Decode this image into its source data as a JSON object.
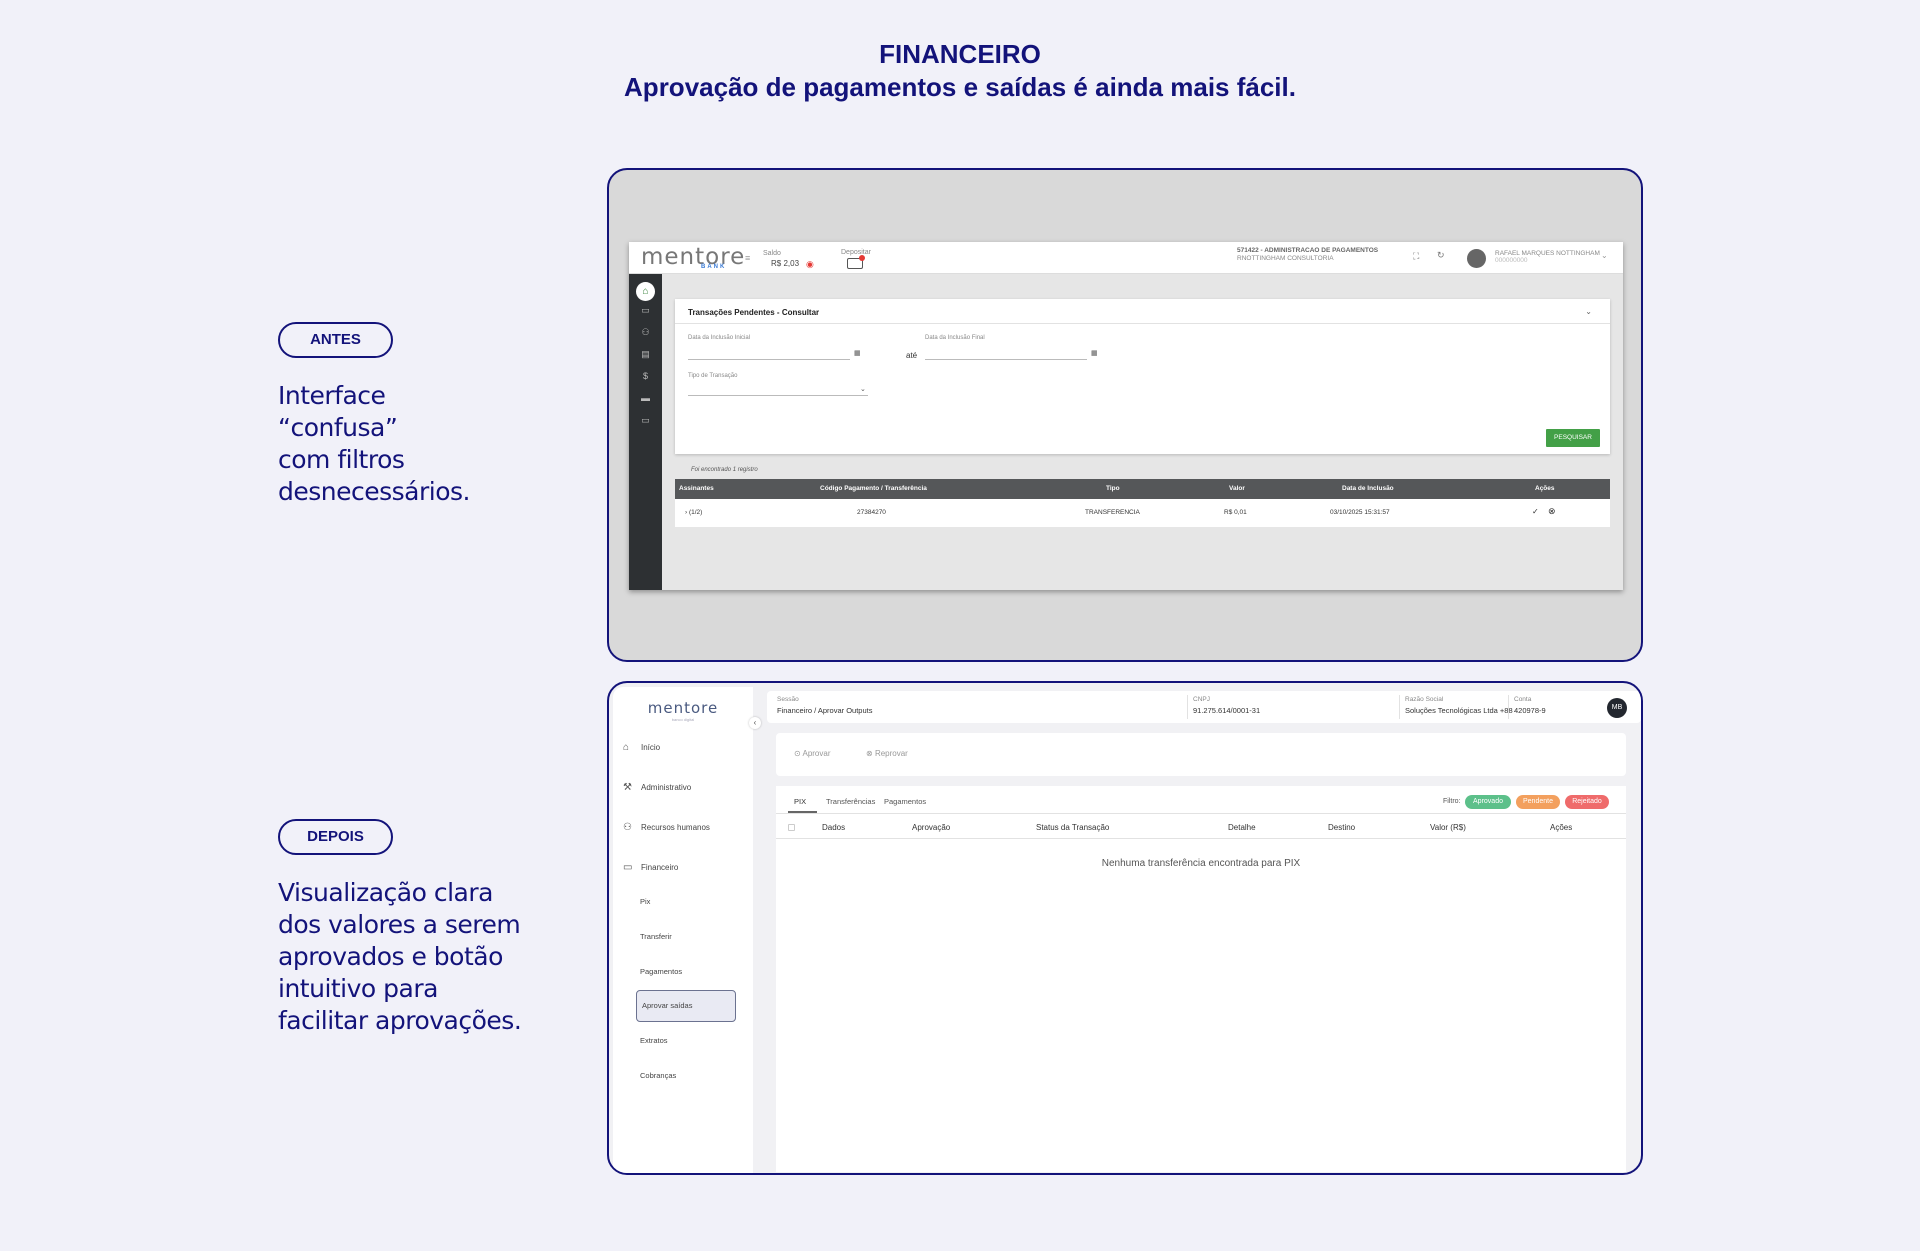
{
  "header": {
    "title": "FINANCEIRO",
    "subtitle": "Aprovação de pagamentos e saídas é ainda mais fácil."
  },
  "before": {
    "tag": "ANTES",
    "description": "Interface\n“confusa”\ncom filtros\ndesnecessários.",
    "app": {
      "logo": "mentore",
      "logo_sub": "BANK",
      "saldo_label": "Saldo",
      "saldo_value": "R$ 2,03",
      "depositar_label": "Depositar",
      "account_line1": "571422 - ADMINISTRACAO DE PAGAMENTOS",
      "account_line2": "RNOTTINGHAM CONSULTORIA",
      "user_name": "RAFAEL MARQUES NOTTINGHAM",
      "user_sub": "000000000",
      "card_title": "Transações Pendentes - Consultar",
      "label_date_start": "Data da Inclusão Inicial",
      "label_date_end": "Data da Inclusão Final",
      "label_ate": "até",
      "label_tipo": "Tipo de Transação",
      "search_button": "PESQUISAR",
      "found_text": "Foi encontrado 1 registro",
      "columns": [
        "Assinantes",
        "Código Pagamento / Transferência",
        "Tipo",
        "Valor",
        "Data de Inclusão",
        "Ações"
      ],
      "row": {
        "assinantes": "› (1/2)",
        "codigo": "27384270",
        "tipo": "TRANSFERENCIA",
        "valor": "R$ 0,01",
        "data": "03/10/2025 15:31:57"
      }
    }
  },
  "after": {
    "tag": "DEPOIS",
    "description": "Visualização clara\ndos valores a serem\naprovados e botão\nintuitivo para\nfacilitar aprovações.",
    "app": {
      "logo": "mentore",
      "logo_sub": "banco digital",
      "nav": [
        {
          "label": "Início",
          "icon": "home-icon"
        },
        {
          "label": "Administrativo",
          "icon": "wrench-icon"
        },
        {
          "label": "Recursos humanos",
          "icon": "people-icon"
        },
        {
          "label": "Financeiro",
          "icon": "money-icon"
        }
      ],
      "sub_nav": [
        "Pix",
        "Transferir",
        "Pagamentos",
        "Aprovar saídas",
        "Extratos",
        "Cobranças"
      ],
      "sessao_label": "Sessão",
      "sessao_value": "Financeiro / Aprovar Outputs",
      "cnpj_label": "CNPJ",
      "cnpj_value": "91.275.614/0001-31",
      "razao_label": "Razão Social",
      "razao_value": "Soluções Tecnológicas Ltda +88",
      "conta_label": "Conta",
      "conta_value": "420978-9",
      "avatar_initials": "MB",
      "aprovar": "Aprovar",
      "reprovar": "Reprovar",
      "tabs": [
        "PIX",
        "Transferências",
        "Pagamentos"
      ],
      "filtro_label": "Filtro:",
      "filters": [
        {
          "label": "Aprovado",
          "color": "#5cc08a"
        },
        {
          "label": "Pendente",
          "color": "#f3a05e"
        },
        {
          "label": "Rejeitado",
          "color": "#ef6b6b"
        }
      ],
      "columns": [
        "Dados",
        "Aprovação",
        "Status da Transação",
        "Detalhe",
        "Destino",
        "Valor (R$)",
        "Ações"
      ],
      "empty_text": "Nenhuma transferência encontrada para PIX"
    }
  }
}
